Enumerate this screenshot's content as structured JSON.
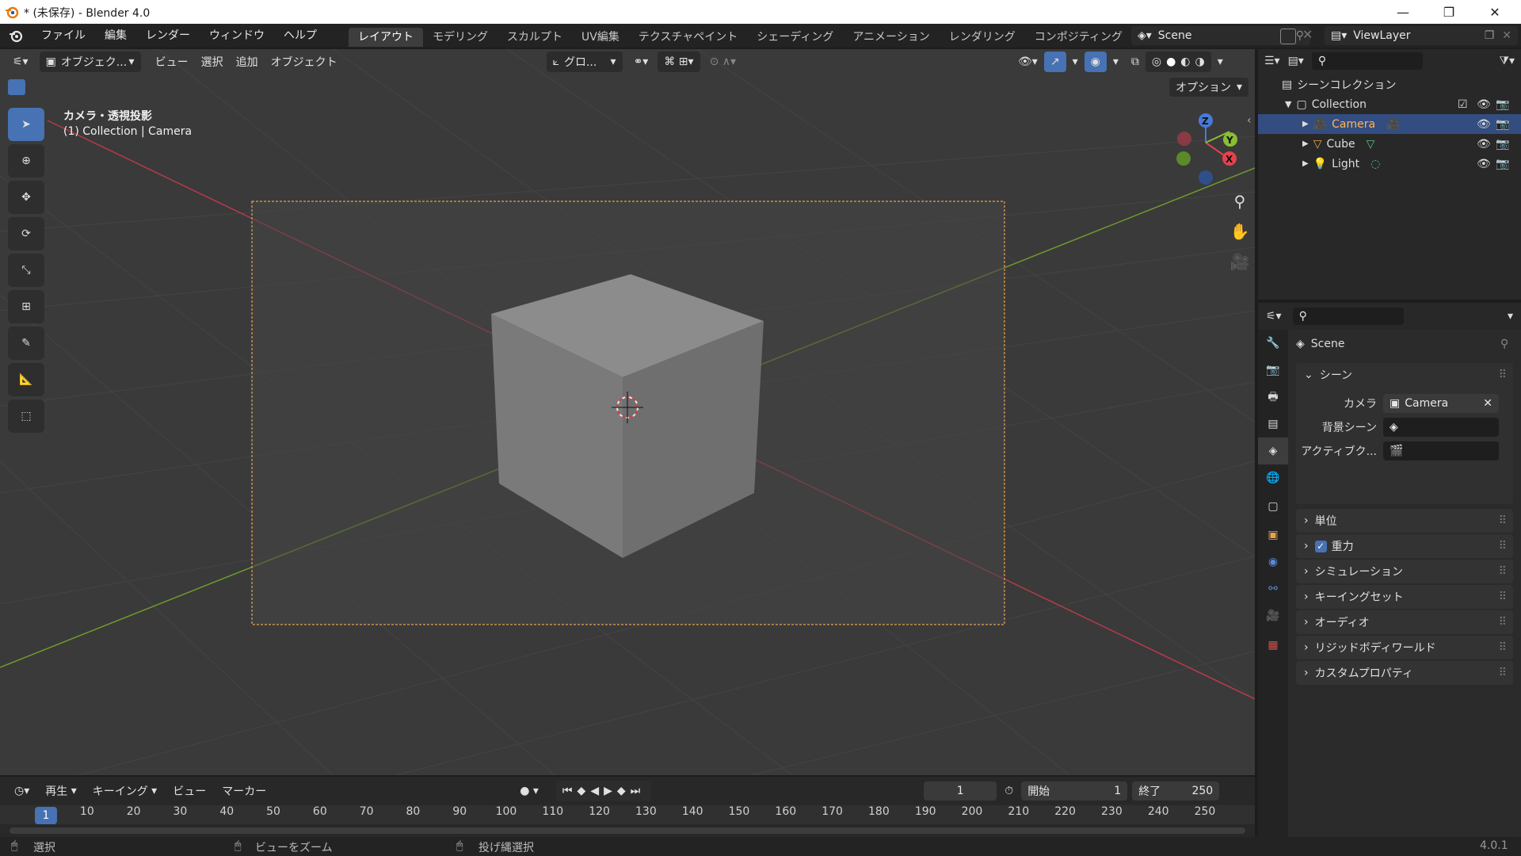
{
  "window": {
    "title": "* (未保存) - Blender 4.0"
  },
  "menu": [
    "ファイル",
    "編集",
    "レンダー",
    "ウィンドウ",
    "ヘルプ"
  ],
  "workspaces": [
    {
      "label": "レイアウト",
      "active": true
    },
    {
      "label": "モデリング"
    },
    {
      "label": "スカルプト"
    },
    {
      "label": "UV編集"
    },
    {
      "label": "テクスチャペイント"
    },
    {
      "label": "シェーディング"
    },
    {
      "label": "アニメーション"
    },
    {
      "label": "レンダリング"
    },
    {
      "label": "コンポジティング"
    }
  ],
  "scene_field": "Scene",
  "viewlayer_field": "ViewLayer",
  "viewport_header": {
    "mode": "オブジェク...",
    "menus": [
      "ビュー",
      "選択",
      "追加",
      "オブジェクト"
    ],
    "transform_orientation": "グロ...",
    "options": "オプション"
  },
  "viewport": {
    "view_name": "カメラ・透視投影",
    "view_info": "(1) Collection | Camera"
  },
  "outliner": {
    "root": "シーンコレクション",
    "collection": "Collection",
    "items": [
      {
        "label": "Camera",
        "selected": true
      },
      {
        "label": "Cube"
      },
      {
        "label": "Light"
      }
    ]
  },
  "properties": {
    "context": "Scene",
    "panel_open": "シーン",
    "camera_label": "カメラ",
    "camera_value": "Camera",
    "bg_scene_label": "背景シーン",
    "active_clip_label": "アクティブク...",
    "panels": [
      "単位",
      "重力",
      "シミュレーション",
      "キーイングセット",
      "オーディオ",
      "リジッドボディワールド",
      "カスタムプロパティ"
    ]
  },
  "timeline": {
    "menus": [
      "再生",
      "キーイング",
      "ビュー",
      "マーカー"
    ],
    "current_frame": "1",
    "start_label": "開始",
    "start": "1",
    "end_label": "終了",
    "end": "250",
    "ticks": [
      "10",
      "20",
      "30",
      "40",
      "50",
      "60",
      "70",
      "80",
      "90",
      "100",
      "110",
      "120",
      "130",
      "140",
      "150",
      "160",
      "170",
      "180",
      "190",
      "200",
      "210",
      "220",
      "230",
      "240",
      "250"
    ]
  },
  "statusbar": {
    "select": "選択",
    "zoom": "ビューをズーム",
    "lasso": "投げ縄選択",
    "version": "4.0.1"
  },
  "colors": {
    "accent": "#4772b3",
    "selection": "#334d80",
    "camera_frame": "#e8a34a"
  }
}
